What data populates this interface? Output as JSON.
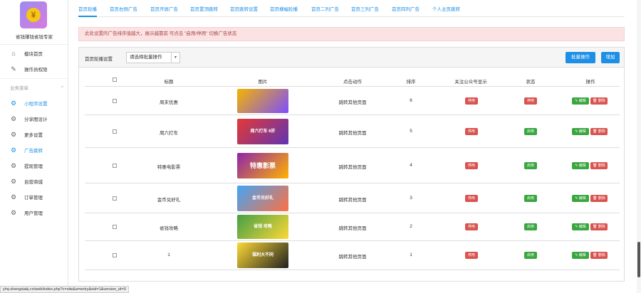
{
  "brand": {
    "logo_icon": "coin-icon",
    "logo_glyph": "¥",
    "name": "省钱赚钱省钱专家"
  },
  "sidebar": {
    "top_items": [
      {
        "label": "模块首页",
        "icon": "home-icon"
      },
      {
        "label": "操作员权限",
        "icon": "edit-icon"
      }
    ],
    "section_label": "业务菜单",
    "items": [
      {
        "label": "小程序设置",
        "icon": "gear-icon",
        "active": true
      },
      {
        "label": "分享图设计",
        "icon": "gear-icon"
      },
      {
        "label": "更多设置",
        "icon": "gear-icon"
      },
      {
        "label": "广告跳转",
        "icon": "gear-icon",
        "active": true
      },
      {
        "label": "提现管理",
        "icon": "gear-icon"
      },
      {
        "label": "自营商城",
        "icon": "gear-icon"
      },
      {
        "label": "订单管理",
        "icon": "gear-icon"
      },
      {
        "label": "用户管理",
        "icon": "gear-icon"
      }
    ]
  },
  "tabs": [
    "首页轮播",
    "首页右侧广告",
    "首页开屏广告",
    "首页置顶跳转",
    "首页跳转设置",
    "首页横幅轮播",
    "首页二列广告",
    "首页三列广告",
    "首页四列广告",
    "个人主页跳转"
  ],
  "alert": "此处设置的广告排序值越大，展示越靠前    可点击 \"启用/停用\" 切换广告状态",
  "panel": {
    "title": "首页轮播设置",
    "select_value": "请选择批量操作",
    "batch_button": "批量操作",
    "add_button": "增加"
  },
  "table": {
    "headers": [
      "标题",
      "图片",
      "点击动作",
      "排序",
      "关注公众号显示",
      "状态",
      "操作"
    ],
    "rows": [
      {
        "title": "周末优惠",
        "image_text": "",
        "image_colors": [
          "#f4b400",
          "#7c4dff"
        ],
        "action": "跳转其他页面",
        "sort": "6",
        "follow": "停用",
        "follow_color": "red",
        "status": "停用",
        "status_color": "red"
      },
      {
        "title": "周六打车",
        "image_text": "周六打车 6折",
        "image_colors": [
          "#e53935",
          "#5e35b1"
        ],
        "action": "跳转其他页面",
        "sort": "5",
        "follow": "停用",
        "follow_color": "red",
        "status": "启用",
        "status_color": "green"
      },
      {
        "title": "特惠电影票",
        "image_text": "特惠影票",
        "image_colors": [
          "#8e24aa",
          "#ffb300"
        ],
        "action": "跳转其他页面",
        "sort": "4",
        "follow": "停用",
        "follow_color": "red",
        "status": "启用",
        "status_color": "green"
      },
      {
        "title": "金币兑好礼",
        "image_text": "金币兑好礼",
        "image_colors": [
          "#42a5f5",
          "#ff7043"
        ],
        "action": "跳转其他页面",
        "sort": "3",
        "follow": "停用",
        "follow_color": "red",
        "status": "启用",
        "status_color": "green"
      },
      {
        "title": "省钱攻略",
        "image_text": "省钱  攻略",
        "image_colors": [
          "#43a047",
          "#fdd835"
        ],
        "action": "跳转其他页面",
        "sort": "2",
        "follow": "停用",
        "follow_color": "red",
        "status": "启用",
        "status_color": "green"
      },
      {
        "title": "1",
        "image_text": "福利大不同",
        "image_colors": [
          "#fdd835",
          "#212121"
        ],
        "action": "跳转其他页面",
        "sort": "1",
        "follow": "停用",
        "follow_color": "red",
        "status": "启用",
        "status_color": "green"
      }
    ],
    "edit_label": "✎ 编辑",
    "delete_label": "🗑 删除"
  },
  "status_bar_url": "yhq.shengxiakj.cn/web/index.php?c=site&a=entry&eid=1&version_id=0",
  "colors": {
    "accent": "#1e8fe6",
    "danger": "#d9534f",
    "success": "#3aa640",
    "alert_bg": "#fbe3e4"
  }
}
